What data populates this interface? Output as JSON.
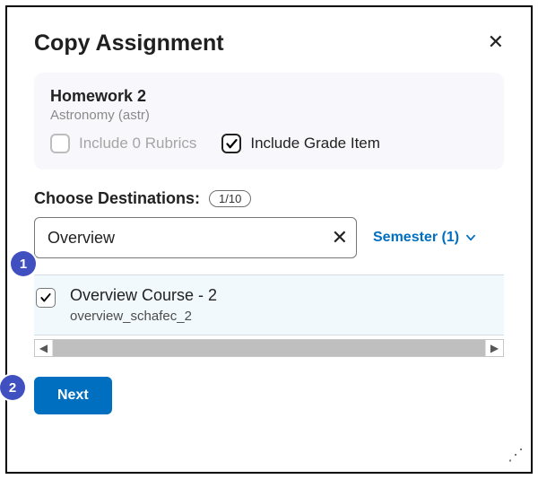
{
  "dialog": {
    "title": "Copy Assignment"
  },
  "summary": {
    "title": "Homework 2",
    "subtitle": "Astronomy (astr)",
    "include_rubrics_label": "Include 0 Rubrics",
    "include_grade_label": "Include Grade Item"
  },
  "destinations": {
    "label": "Choose Destinations:",
    "count_pill": "1/10",
    "search_value": "Overview",
    "filter_label": "Semester (1)"
  },
  "results": [
    {
      "title": "Overview Course - 2",
      "subtitle": "overview_schafec_2"
    }
  ],
  "actions": {
    "next": "Next"
  },
  "annotations": {
    "one": "1",
    "two": "2"
  }
}
